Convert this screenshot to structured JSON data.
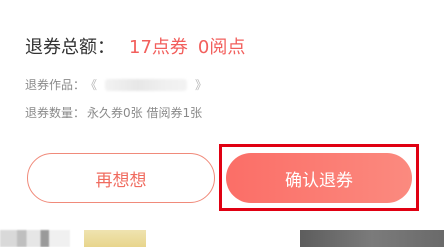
{
  "dialog": {
    "total_label": "退券总额：",
    "total_points": "17点券",
    "total_reading": "0阅点",
    "work_label": "退券作品：",
    "work_open_bracket": "《",
    "work_close_bracket": "》",
    "count_label": "退券数量：",
    "count_value": "永久券0张 借阅券1张"
  },
  "buttons": {
    "cancel_label": "再想想",
    "confirm_label": "确认退券"
  },
  "colors": {
    "accent": "#f25f5c",
    "confirm_gradient_start": "#fb6e67",
    "confirm_gradient_end": "#fb8a7f",
    "highlight": "#e00012"
  }
}
